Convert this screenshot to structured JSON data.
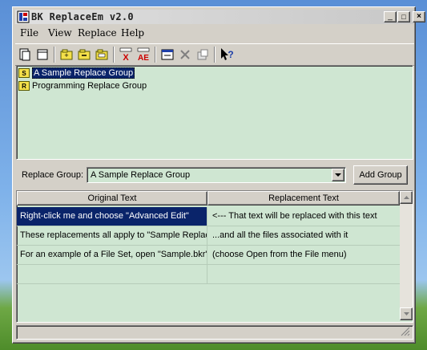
{
  "window": {
    "title": "BK ReplaceEm v2.0"
  },
  "caption_buttons": {
    "minimize": "_",
    "maximize": "□",
    "close": "×"
  },
  "menu": [
    "File",
    "View",
    "Replace",
    "Help"
  ],
  "toolbar": {
    "icons": [
      "new-file-icon",
      "blank-doc-icon",
      "add-group-icon",
      "remove-group-icon",
      "rename-group-icon",
      "delete-replacement-icon",
      "advanced-edit-icon",
      "edit-icon",
      "delete-icon",
      "properties-icon",
      "context-help-icon"
    ],
    "labels": {
      "delete_x": "X",
      "advanced_ae": "AE",
      "help": "?"
    }
  },
  "groups": [
    {
      "label": "A Sample Replace Group",
      "icon": "S",
      "selected": true
    },
    {
      "label": "Programming Replace Group",
      "icon": "R",
      "selected": false
    }
  ],
  "replace_group": {
    "label": "Replace Group:",
    "value": "A Sample Replace Group"
  },
  "add_group_button": "Add Group",
  "table": {
    "columns": [
      "Original Text",
      "Replacement Text"
    ],
    "rows": [
      [
        "Right-click me and choose \"Advanced Edit\"",
        "<--- That text will be replaced with this text"
      ],
      [
        "These replacements all apply to \"Sample Replace",
        "...and all the files associated with it"
      ],
      [
        "For an example of a File Set, open \"Sample.bkr\"",
        "(choose Open from the File menu)"
      ]
    ]
  },
  "colors": {
    "accent": "#0a246a",
    "panel_bg": "#cfe6d2",
    "window_bg": "#d4d0c8"
  }
}
